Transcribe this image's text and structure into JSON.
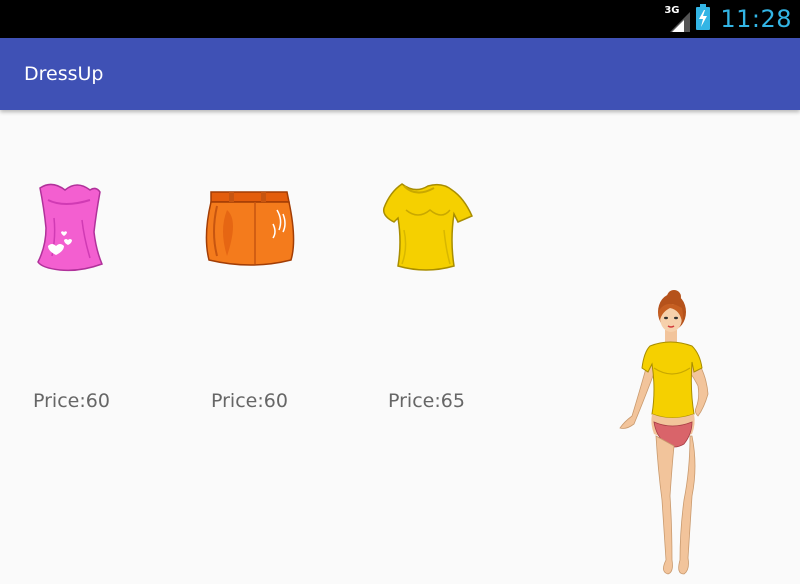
{
  "status_bar": {
    "network_label": "3G",
    "time": "11:28",
    "icons": [
      "signal-icon",
      "battery-charging-icon"
    ],
    "clock_color": "#33b5e5"
  },
  "app_bar": {
    "title": "DressUp",
    "color": "#3f51b5"
  },
  "items": [
    {
      "name": "pink tube top",
      "icon": "pink-top-icon",
      "price_label": "Price:60"
    },
    {
      "name": "orange skirt",
      "icon": "orange-skirt-icon",
      "price_label": "Price:60"
    },
    {
      "name": "yellow t-shirt",
      "icon": "yellow-tshirt-icon",
      "price_label": "Price:65"
    }
  ],
  "model": {
    "icon": "dress-up-model-figure",
    "wearing": "yellow-tshirt"
  }
}
